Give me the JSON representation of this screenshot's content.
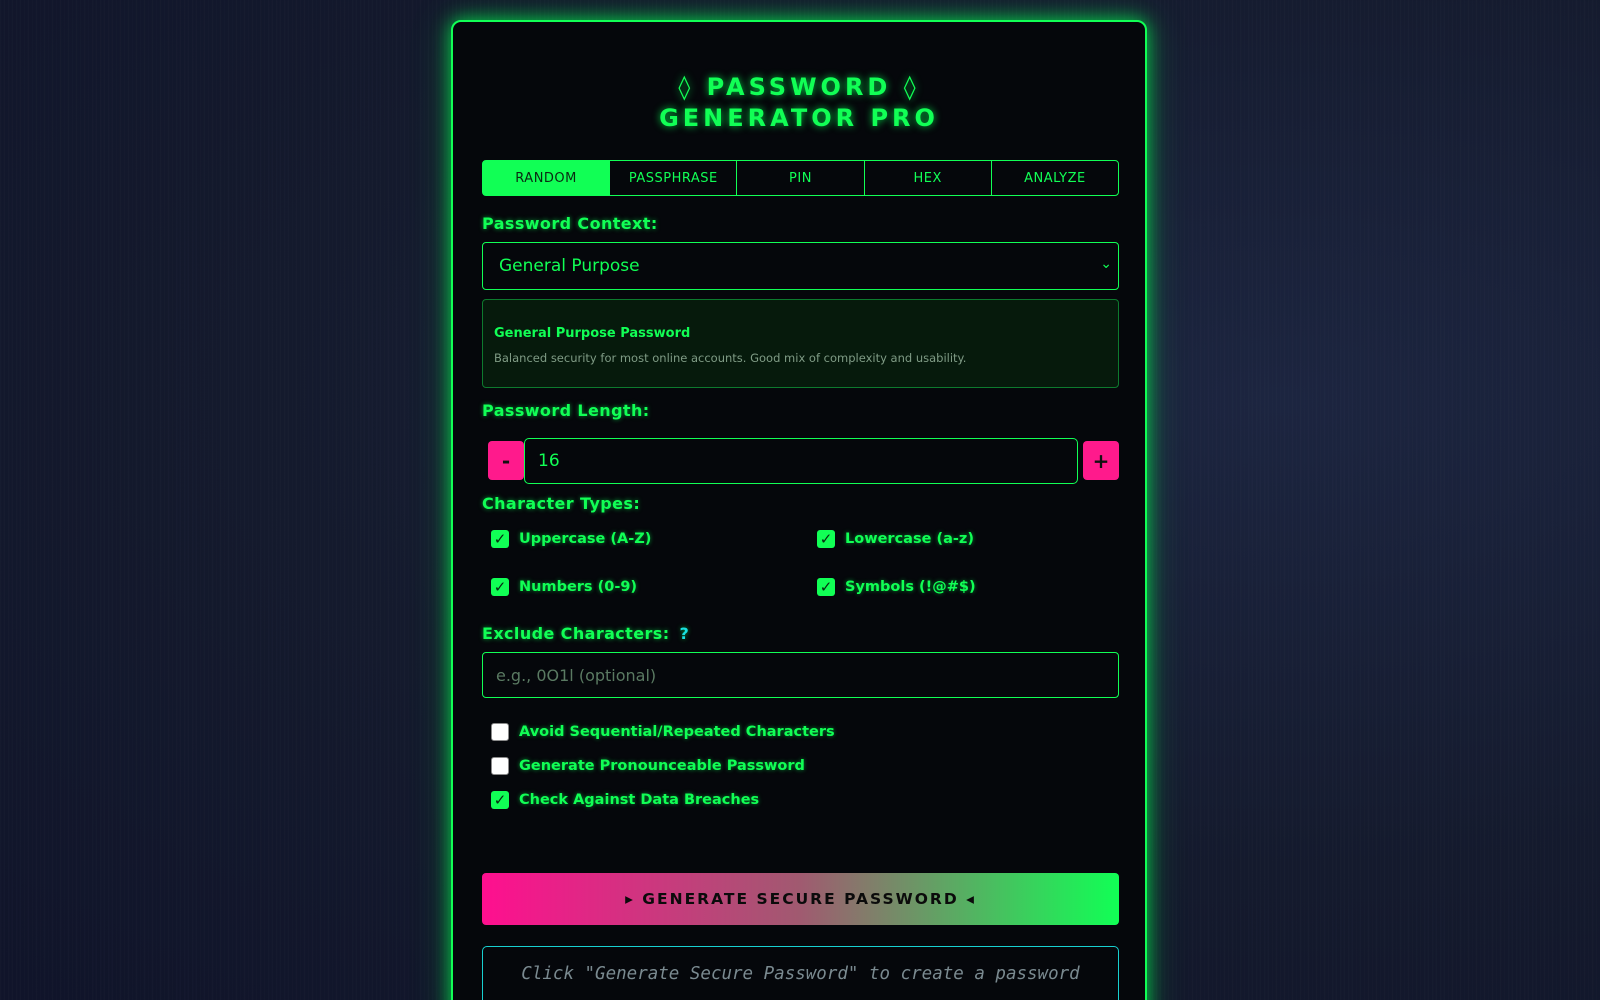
{
  "title": {
    "line1": "◊ PASSWORD ◊",
    "line2": "GENERATOR PRO"
  },
  "tabs": [
    {
      "label": "RANDOM",
      "active": true
    },
    {
      "label": "PASSPHRASE",
      "active": false
    },
    {
      "label": "PIN",
      "active": false
    },
    {
      "label": "HEX",
      "active": false
    },
    {
      "label": "ANALYZE",
      "active": false
    }
  ],
  "context": {
    "label": "Password Context:",
    "selected": "General Purpose",
    "info_title": "General Purpose Password",
    "info_desc": "Balanced security for most online accounts. Good mix of complexity and usability."
  },
  "length": {
    "label": "Password Length:",
    "minus": "-",
    "plus": "+",
    "value": "16"
  },
  "char_types": {
    "label": "Character Types:",
    "options": [
      {
        "label": "Uppercase (A-Z)",
        "checked": true
      },
      {
        "label": "Lowercase (a-z)",
        "checked": true
      },
      {
        "label": "Numbers (0-9)",
        "checked": true
      },
      {
        "label": "Symbols (!@#$)",
        "checked": true
      }
    ]
  },
  "exclude": {
    "label": "Exclude Characters:",
    "help": "?",
    "placeholder": "e.g., 0O1l (optional)"
  },
  "options": [
    {
      "label": "Avoid Sequential/Repeated Characters",
      "checked": false
    },
    {
      "label": "Generate Pronounceable Password",
      "checked": false
    },
    {
      "label": "Check Against Data Breaches",
      "checked": true
    }
  ],
  "generate_button": "▸ GENERATE SECURE PASSWORD ◂",
  "output_placeholder": "Click \"Generate Secure Password\" to create a password",
  "colors": {
    "neon_green": "#11ff55",
    "neon_pink": "#ff1a8c",
    "cyan": "#18d0d0",
    "background": "#141a2d"
  }
}
